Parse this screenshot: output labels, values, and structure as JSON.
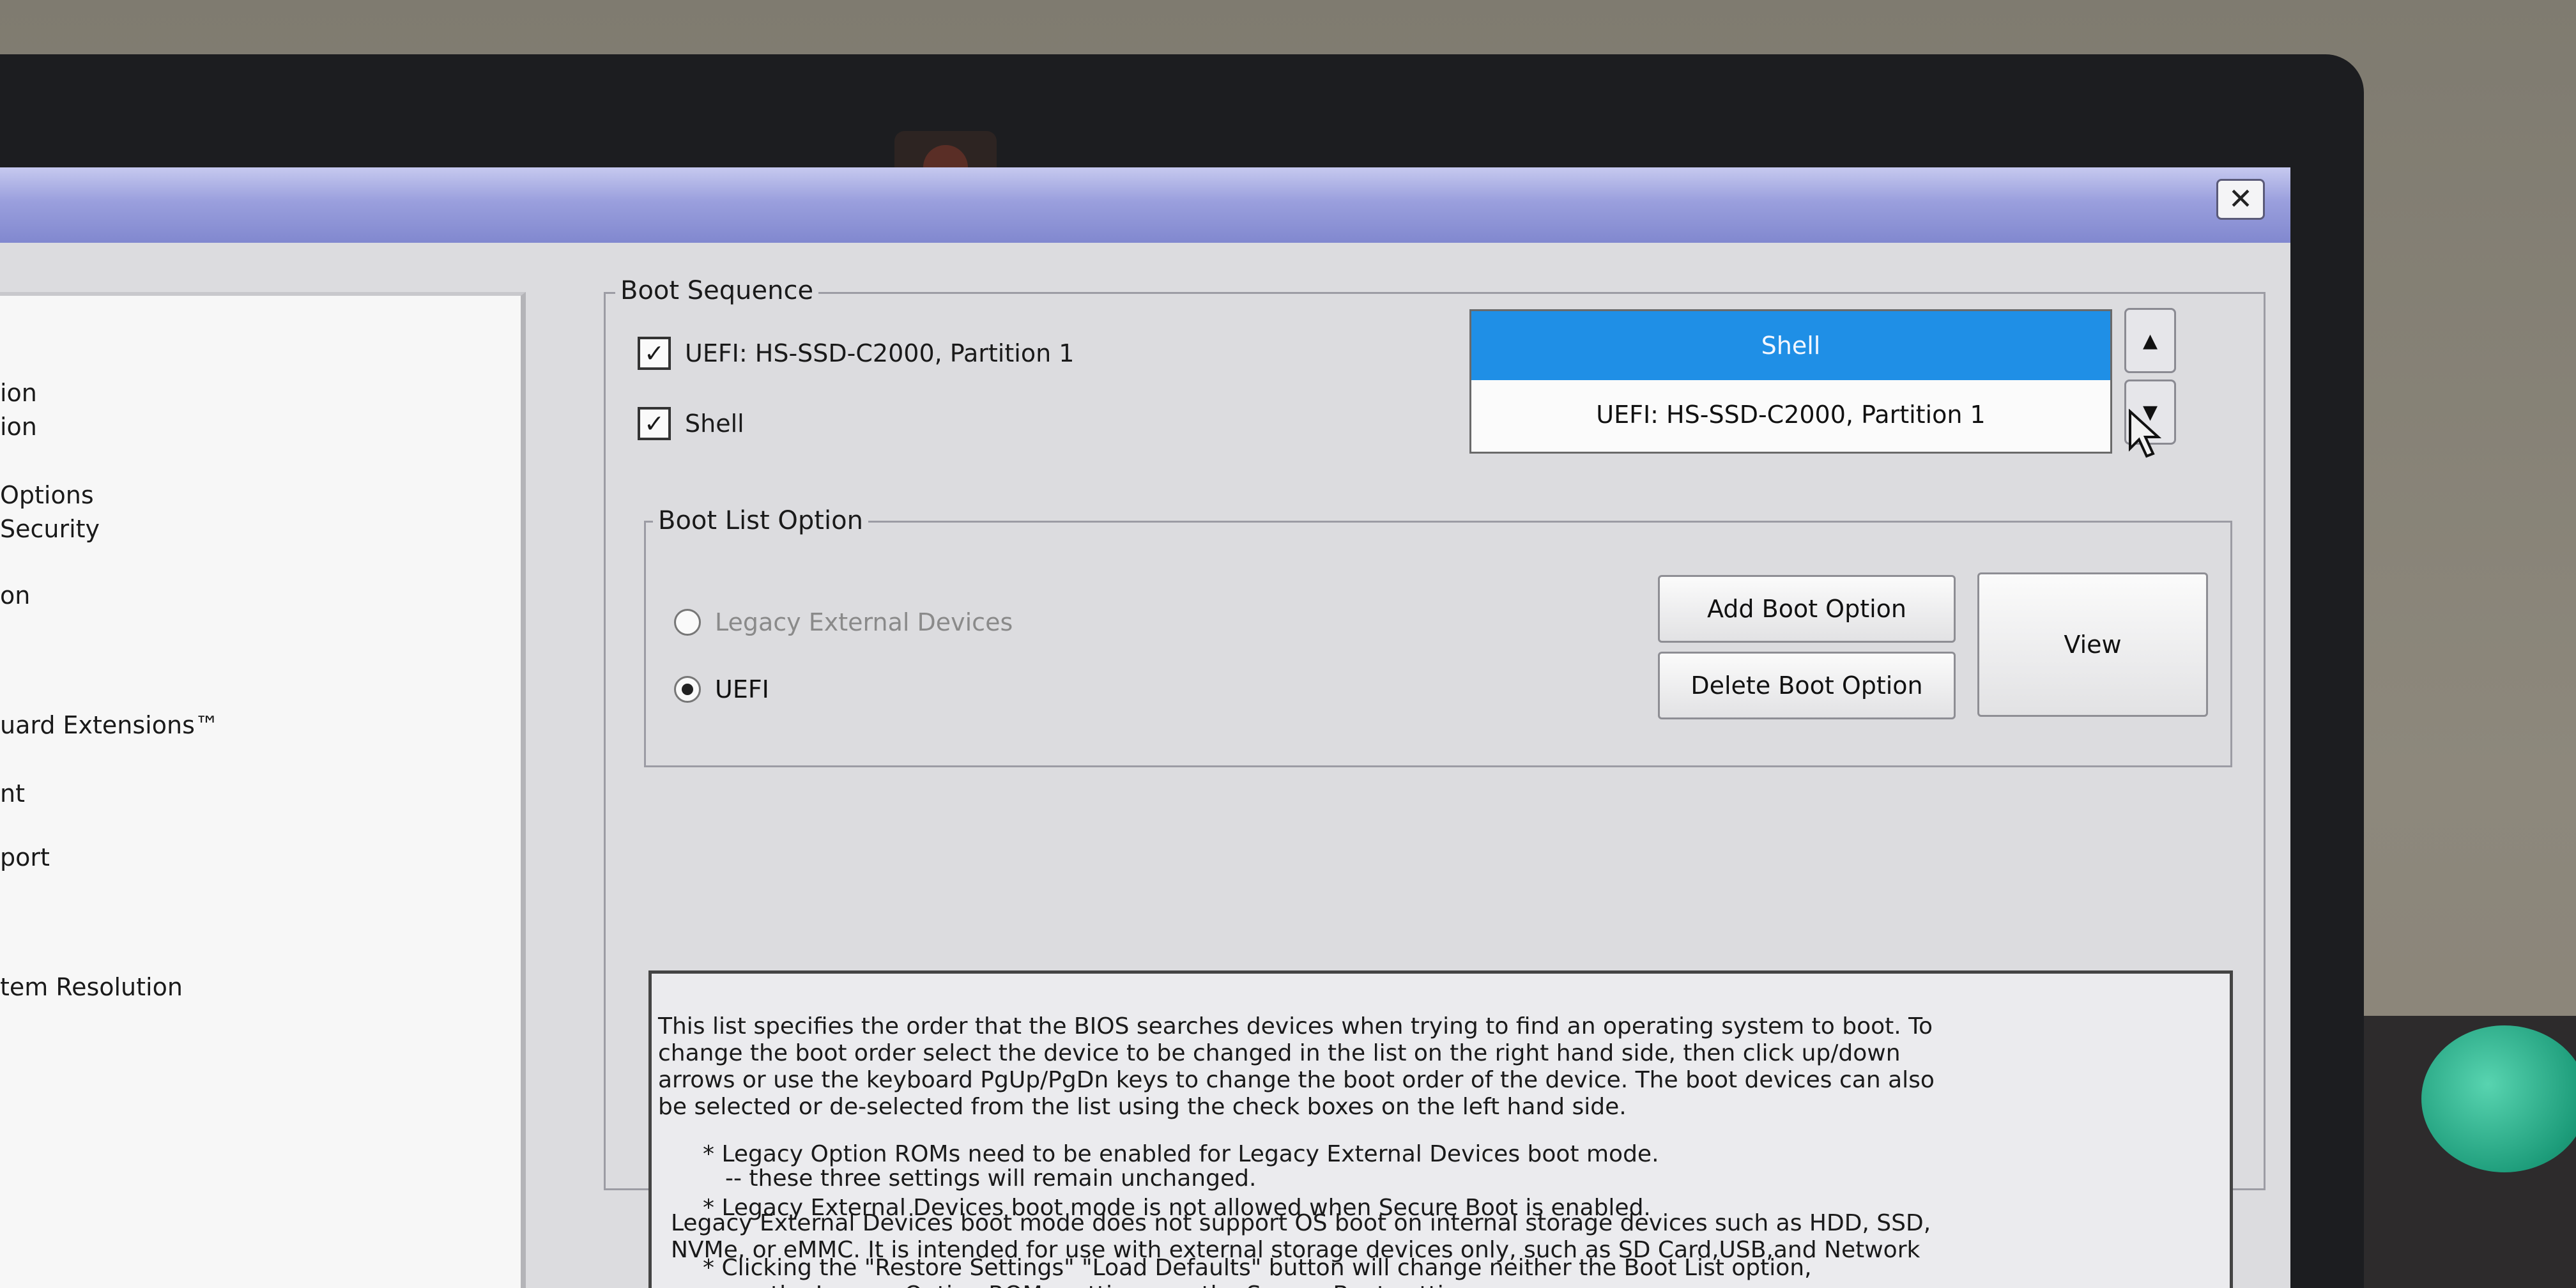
{
  "window": {
    "close_label": "✕"
  },
  "sidebar": {
    "items": [
      {
        "label": "ion"
      },
      {
        "label": "ion"
      },
      {
        "label": "Options"
      },
      {
        "label": "Security"
      },
      {
        "label": "on"
      },
      {
        "label": "uard Extensions™"
      },
      {
        "label": "nt"
      },
      {
        "label": "port"
      },
      {
        "label": "tem Resolution"
      }
    ]
  },
  "boot_sequence": {
    "legend": "Boot Sequence",
    "entries": [
      {
        "label": "UEFI: HS-SSD-C2000, Partition 1",
        "checked": true
      },
      {
        "label": "Shell",
        "checked": true
      }
    ],
    "order_list": [
      {
        "label": "Shell",
        "selected": true
      },
      {
        "label": "UEFI: HS-SSD-C2000, Partition 1",
        "selected": false
      }
    ],
    "move_up_icon": "triangle-up-icon",
    "move_down_icon": "triangle-down-icon"
  },
  "boot_list_option": {
    "legend": "Boot List Option",
    "options": [
      {
        "label": "Legacy External Devices",
        "selected": false,
        "enabled": false
      },
      {
        "label": "UEFI",
        "selected": true,
        "enabled": true
      }
    ],
    "add_button": "Add Boot Option",
    "delete_button": "Delete Boot Option",
    "view_button": "View"
  },
  "help": {
    "lines": [
      "This list specifies the order that the BIOS searches devices when trying to find an operating system to boot. To",
      "change the boot order select the device to be changed in the list on the right hand side, then click up/down",
      "arrows or use the keyboard PgUp/PgDn keys to change the boot order of the device. The boot devices can also",
      "be selected or de-selected from the list using the check boxes on the left hand side.",
      "* Legacy Option ROMs need to be enabled for Legacy External Devices boot mode.",
      "* Legacy External Devices boot mode is not allowed when Secure Boot is enabled.",
      "* Clicking the \"Restore Settings\" \"Load Defaults\" button will change neither the Boot List option,",
      "nor the Legacy Option ROMs setting, nor the Secure Boot setting",
      "-- these three settings will remain unchanged.",
      "Legacy External Devices boot mode does not support OS boot on internal storage devices such as HDD, SSD,",
      "NVMe, or eMMC. It is intended for use with external storage devices only, such as SD Card,USB,and Network"
    ]
  },
  "colors": {
    "selection": "#1f8fe6",
    "titlebar": "#8188cf",
    "window_bg": "#dcdcdf"
  }
}
